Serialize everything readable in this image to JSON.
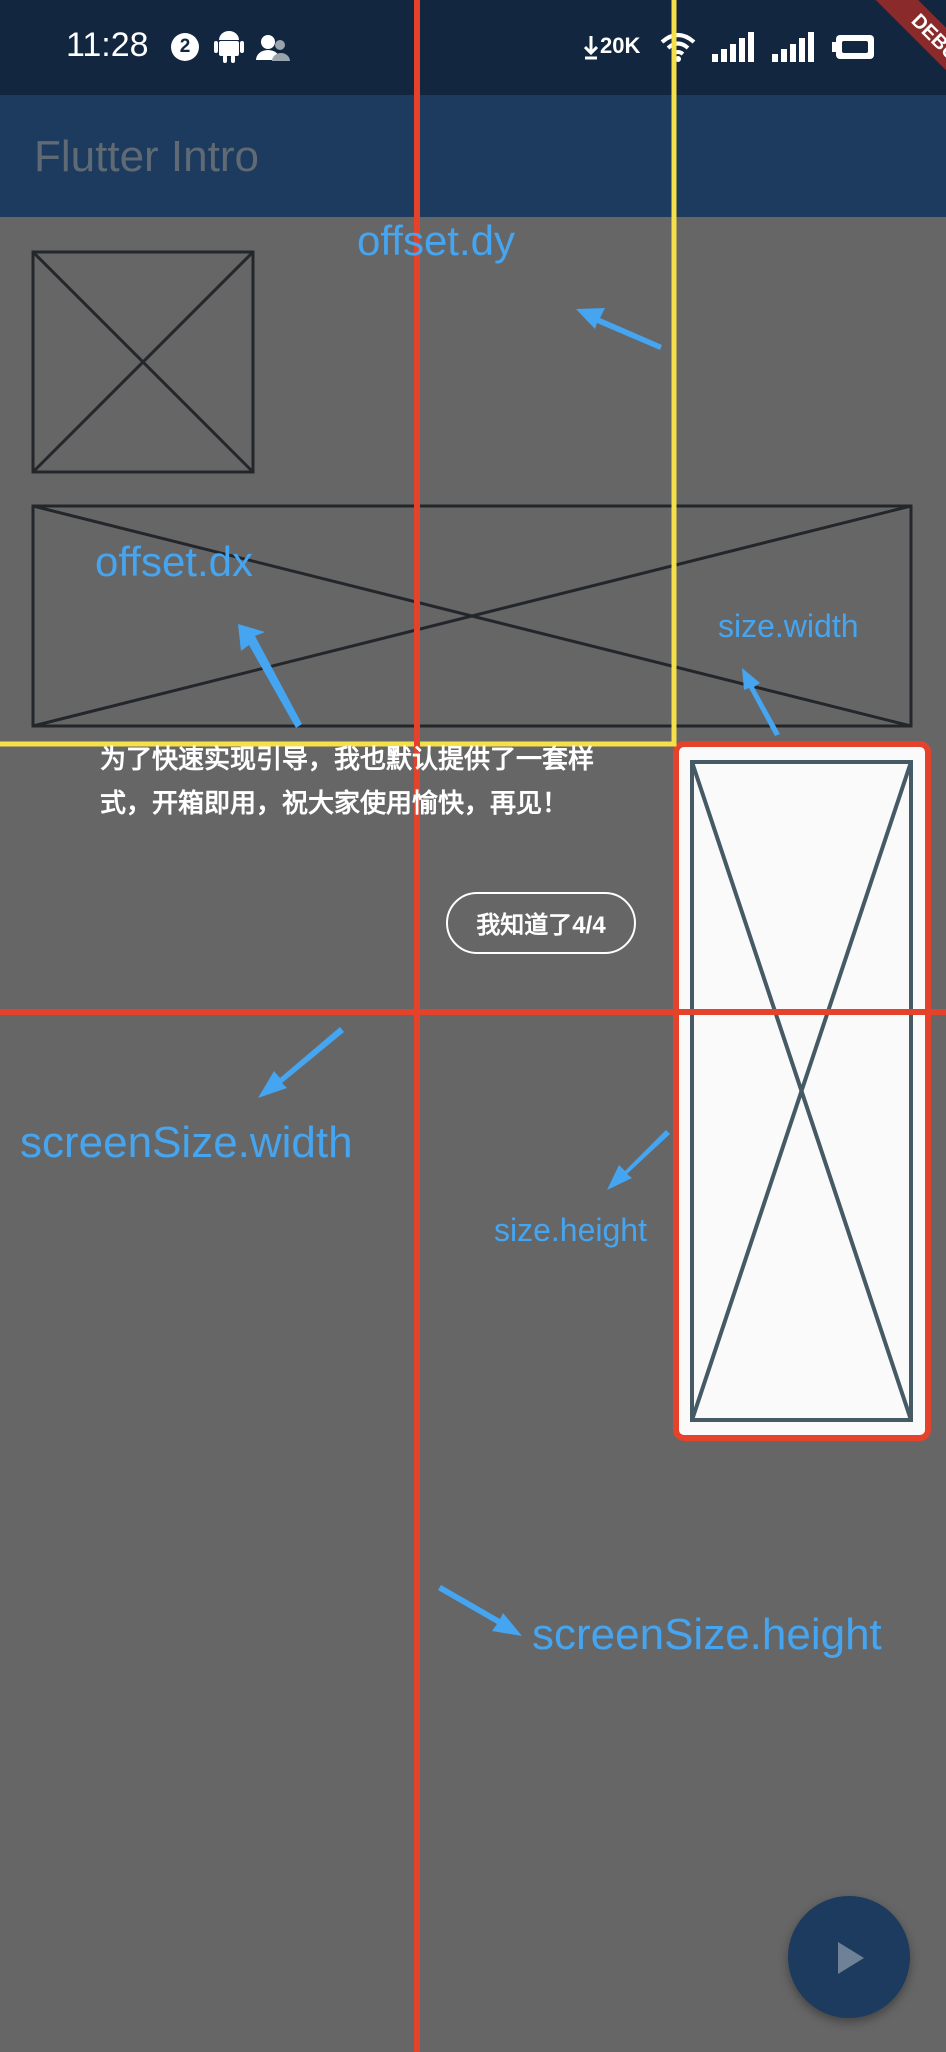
{
  "status_bar": {
    "time": "11:28",
    "notification_count": "2",
    "net_speed": "20K",
    "icons": [
      "android-icon",
      "accounts-icon",
      "download-icon",
      "wifi-icon",
      "signal-icon",
      "signal-2-icon",
      "battery-icon"
    ]
  },
  "app_bar": {
    "title": "Flutter Intro"
  },
  "debug_banner": {
    "label": "DEBUG"
  },
  "annotations": {
    "offset_dy": "offset.dy",
    "offset_dx": "offset.dx",
    "size_width": "size.width",
    "size_height": "size.height",
    "screen_width": "screenSize.width",
    "screen_height": "screenSize.height"
  },
  "intro": {
    "tip_text": "为了快速实现引导，我也默认提供了一套样式，开箱即用，祝大家使用愉快，再见！",
    "button_label": "我知道了4/4"
  },
  "colors": {
    "overlay": "#666666",
    "status_bar": "#122640",
    "app_bar": "#1d3b5e",
    "annotation_blue": "#45a5f0",
    "guide_red": "#e5422b",
    "guide_yellow": "#f5e04a"
  },
  "fab": {
    "icon": "play-icon"
  }
}
